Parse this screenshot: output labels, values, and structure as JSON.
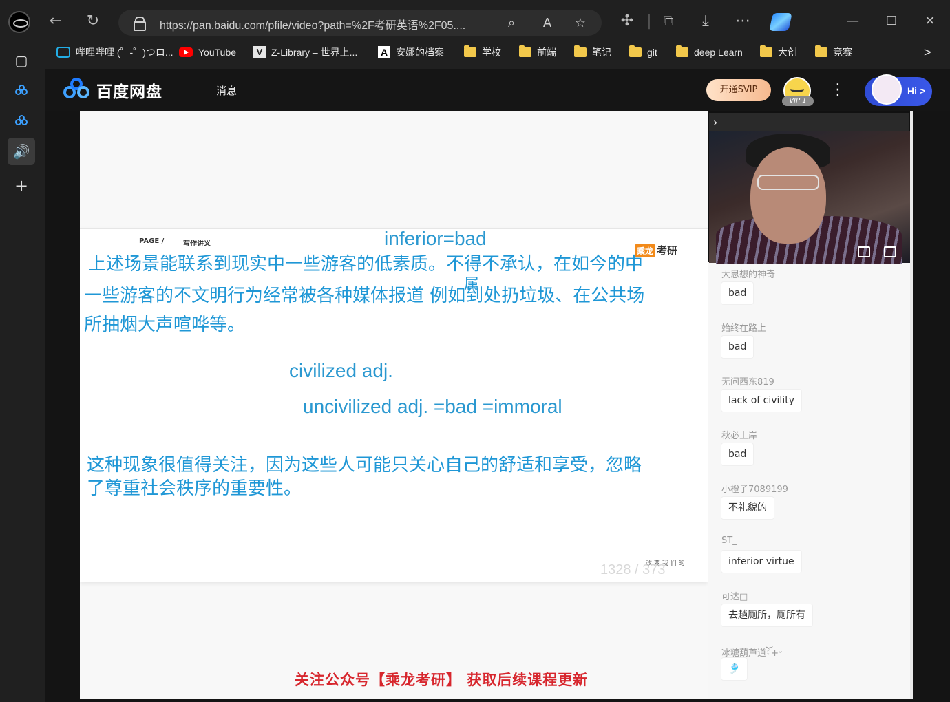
{
  "browser": {
    "url": "https://pan.baidu.com/pfile/video?path=%2F考研英语%2F05....",
    "bookmarks": [
      {
        "label": "哔哩哔哩 (゜-゜)つロ...",
        "icon": "bilibili-icon"
      },
      {
        "label": "YouTube",
        "icon": "youtube-icon"
      },
      {
        "label": "Z-Library – 世界上...",
        "icon": "zlibrary-icon"
      },
      {
        "label": "安娜的档案",
        "icon": "annas-archive-icon"
      },
      {
        "label": "学校",
        "icon": "folder-icon"
      },
      {
        "label": "前端",
        "icon": "folder-icon"
      },
      {
        "label": "笔记",
        "icon": "folder-icon"
      },
      {
        "label": "git",
        "icon": "folder-icon"
      },
      {
        "label": "deep Learn",
        "icon": "folder-icon"
      },
      {
        "label": "大创",
        "icon": "folder-icon"
      },
      {
        "label": "竞赛",
        "icon": "folder-icon"
      }
    ],
    "more_glyph": ">"
  },
  "pan": {
    "brand": "百度网盘",
    "nav_message": "消息",
    "svip_button": "开通SVIP",
    "vip_badge": "VIP 1",
    "hi_label": "Hi",
    "hi_chevron": ">"
  },
  "slide": {
    "page_label": "PAGE /",
    "section_label": "写作讲义",
    "brand_box": "乘龙",
    "brand_text": "考研",
    "annotation_top": "inferior=bad",
    "annotation_overlap": "属",
    "cn_line1": "上述场景能联系到现实中一些游客的低素质。不得不承认，在如今的中",
    "cn_line2": "一些游客的不文明行为经常被各种媒体报道 例如到处扔垃圾、在公共场",
    "cn_line3": "所抽烟大声喧哗等。",
    "vocab1": "civilized adj.",
    "vocab2": "uncivilized adj. =bad =immoral",
    "cn_line4": "这种现象很值得关注，因为这些人可能只关心自己的舒适和享受，忽略",
    "cn_line5": "了尊重社会秩序的重要性。",
    "page_number": "1328 / 373",
    "page_mark": "改 变 我 们 的"
  },
  "banner": "关注公众号【乘龙考研】 获取后续课程更新",
  "chat": [
    {
      "user": "大思想的神奇",
      "text": "bad"
    },
    {
      "user": "始终在路上",
      "text": "bad"
    },
    {
      "user": "无问西东819",
      "text": "lack of civility"
    },
    {
      "user": "秋必上岸",
      "text": "bad"
    },
    {
      "user": "小橙子7089199",
      "text": "不礼貌的"
    },
    {
      "user": "ST_",
      "text": "inferior virtue"
    },
    {
      "user": "可达□",
      "text": "去趟厕所，厕所有"
    },
    {
      "user": "冰糖葫芦道ོ+ᵕ",
      "text": "🎐"
    }
  ]
}
